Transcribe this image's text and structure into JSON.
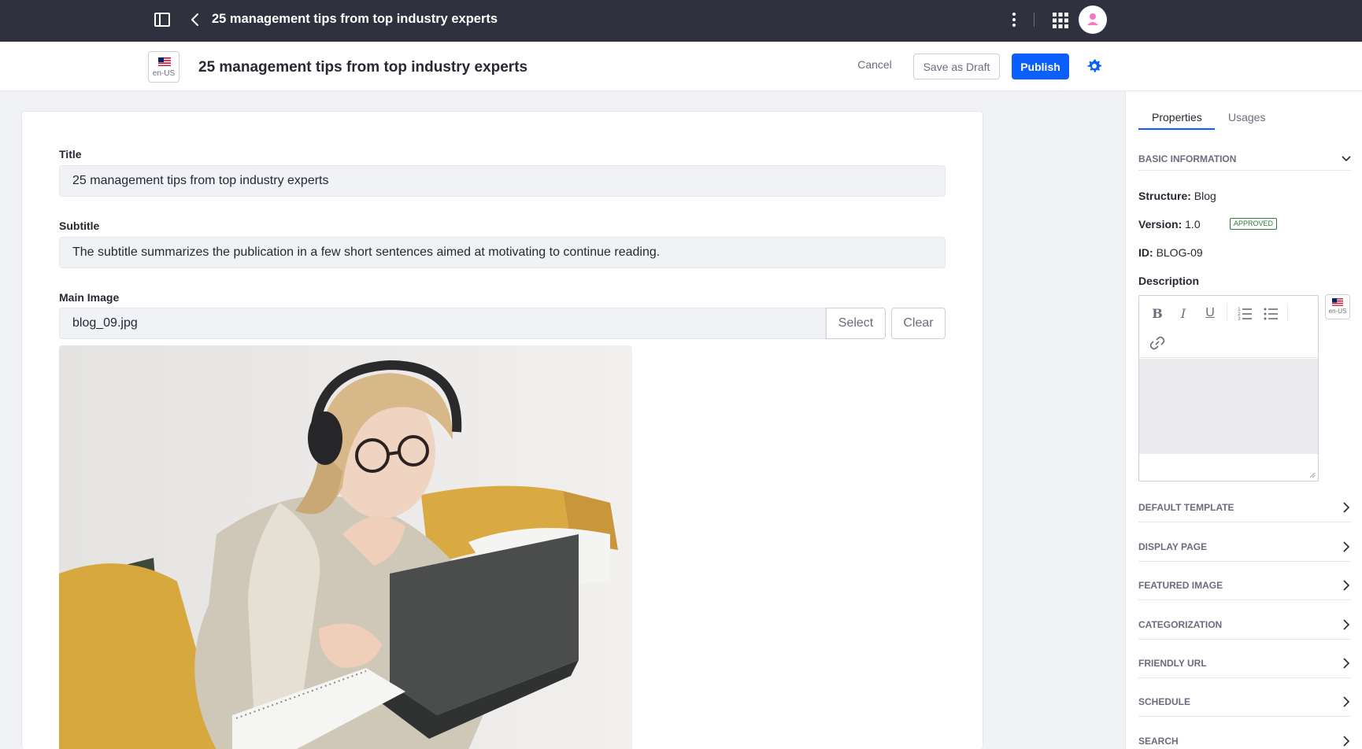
{
  "topbar": {
    "title": "25 management tips from top industry experts",
    "icons": [
      "sidebar-toggle-icon",
      "back-chevron-icon",
      "kebab-icon",
      "apps-grid-icon",
      "user-avatar-icon"
    ]
  },
  "header": {
    "language": "en-US",
    "title": "25 management tips from top industry experts",
    "cancel_label": "Cancel",
    "draft_label": "Save as Draft",
    "publish_label": "Publish"
  },
  "form": {
    "title_label": "Title",
    "title_value": "25 management tips from top industry experts",
    "subtitle_label": "Subtitle",
    "subtitle_value": "The subtitle summarizes the publication in a few short sentences aimed at motivating to continue reading.",
    "main_image_label": "Main Image",
    "main_image_value": "blog_09.jpg",
    "select_label": "Select",
    "clear_label": "Clear"
  },
  "sidebar": {
    "tabs": [
      {
        "label": "Properties",
        "active": true
      },
      {
        "label": "Usages",
        "active": false
      }
    ],
    "basic_information": "BASIC INFORMATION",
    "structure_key": "Structure:",
    "structure_value": "Blog",
    "version_key": "Version:",
    "version_value": "1.0",
    "status_badge": "APPROVED",
    "id_key": "ID:",
    "id_value": "BLOG-09",
    "description_label": "Description",
    "description_lang": "en-US",
    "sections": [
      "DEFAULT TEMPLATE",
      "DISPLAY PAGE",
      "FEATURED IMAGE",
      "CATEGORIZATION",
      "FRIENDLY URL",
      "SCHEDULE",
      "SEARCH"
    ]
  },
  "colors": {
    "topbar": "#30313f",
    "primary": "#0b5fff",
    "approved": "#287d3c",
    "avatar": "#ff73c3"
  }
}
